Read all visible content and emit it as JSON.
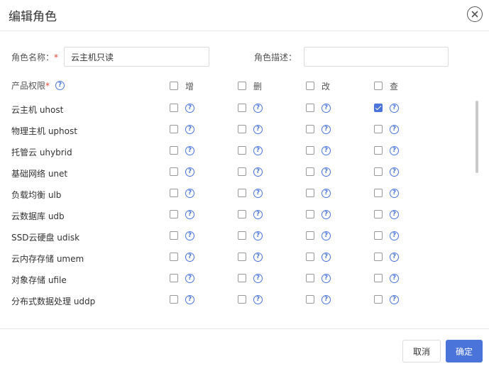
{
  "dialog": {
    "title": "编辑角色",
    "close_icon": "close-icon"
  },
  "form": {
    "role_name_label": "角色名称：",
    "role_name_required_mark": "*",
    "role_name_value": "云主机只读",
    "role_desc_label": "角色描述：",
    "role_desc_value": ""
  },
  "permissions": {
    "header_label": "产品权限",
    "header_required_mark": "*",
    "help_icon": "question-circle-icon",
    "operations": [
      "增",
      "删",
      "改",
      "查"
    ],
    "rows": [
      {
        "label": "云主机 uhost",
        "checked": [
          false,
          false,
          false,
          true
        ]
      },
      {
        "label": "物理主机 uphost",
        "checked": [
          false,
          false,
          false,
          false
        ]
      },
      {
        "label": "托管云 uhybrid",
        "checked": [
          false,
          false,
          false,
          false
        ]
      },
      {
        "label": "基础网络 unet",
        "checked": [
          false,
          false,
          false,
          false
        ]
      },
      {
        "label": "负载均衡 ulb",
        "checked": [
          false,
          false,
          false,
          false
        ]
      },
      {
        "label": "云数据库 udb",
        "checked": [
          false,
          false,
          false,
          false
        ]
      },
      {
        "label": "SSD云硬盘 udisk",
        "checked": [
          false,
          false,
          false,
          false
        ]
      },
      {
        "label": "云内存存储 umem",
        "checked": [
          false,
          false,
          false,
          false
        ]
      },
      {
        "label": "对象存储 ufile",
        "checked": [
          false,
          false,
          false,
          false
        ]
      },
      {
        "label": "分布式数据处理 uddp",
        "checked": [
          false,
          false,
          false,
          false
        ]
      }
    ]
  },
  "footer": {
    "cancel_label": "取消",
    "confirm_label": "确定"
  },
  "colors": {
    "accent": "#4a74d9",
    "required": "#e0463b"
  }
}
